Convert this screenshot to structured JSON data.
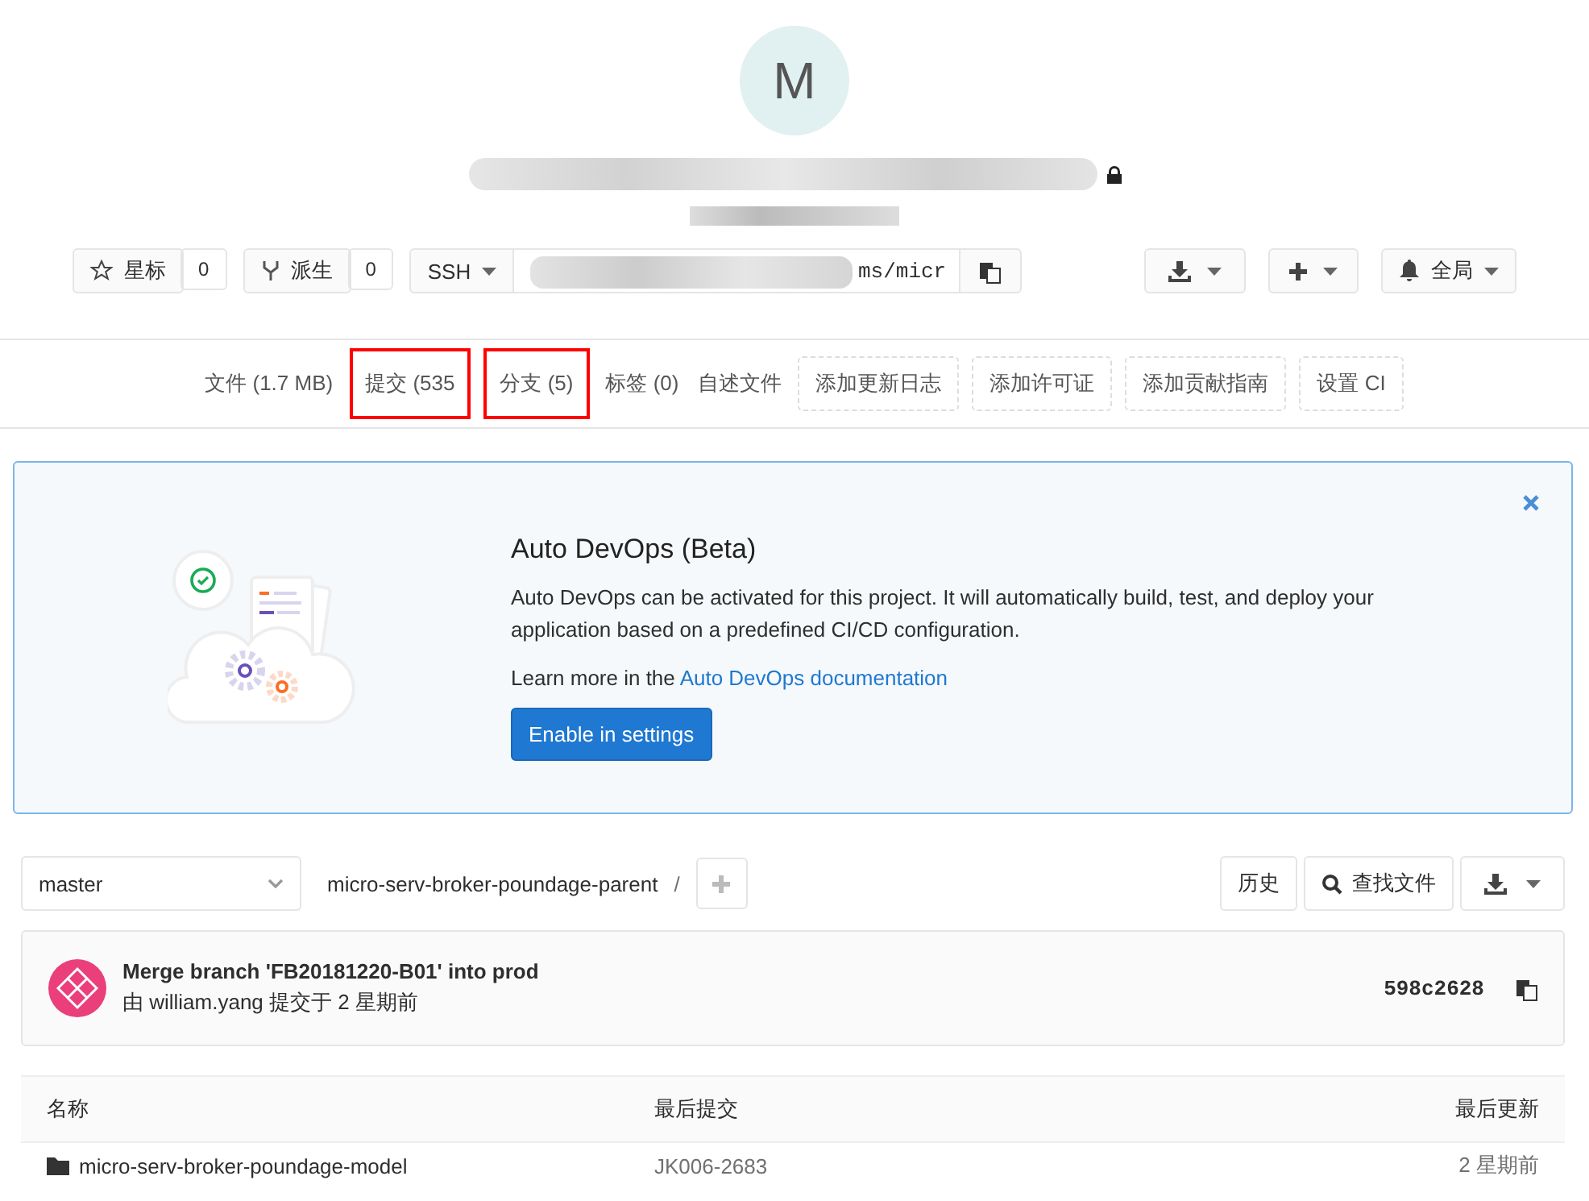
{
  "project": {
    "avatar_letter": "M",
    "private": true
  },
  "actions": {
    "star": {
      "label": "星标",
      "count": "0"
    },
    "fork": {
      "label": "派生",
      "count": "0"
    },
    "clone": {
      "protocol": "SSH",
      "url": "ms/micr"
    },
    "notification": "全局"
  },
  "nav": [
    {
      "label": "文件 (1.7 MB)",
      "kind": "link",
      "highlighted": false
    },
    {
      "label": "提交 (535",
      "kind": "link",
      "highlighted": true
    },
    {
      "label": "分支 (5)",
      "kind": "link",
      "highlighted": true
    },
    {
      "label": "标签 (0)",
      "kind": "link",
      "highlighted": false
    },
    {
      "label": "自述文件",
      "kind": "link",
      "highlighted": false
    },
    {
      "label": "添加更新日志",
      "kind": "dashed"
    },
    {
      "label": "添加许可证",
      "kind": "dashed"
    },
    {
      "label": "添加贡献指南",
      "kind": "dashed"
    },
    {
      "label": "设置 CI",
      "kind": "dashed"
    }
  ],
  "banner": {
    "title": "Auto DevOps (Beta)",
    "text": "Auto DevOps can be activated for this project. It will automatically build, test, and deploy your application based on a predefined CI/CD configuration.",
    "learn_prefix": "Learn more in the",
    "learn_link": "Auto DevOps documentation",
    "button": "Enable in settings"
  },
  "tree_bar": {
    "branch": "master",
    "path": "micro-serv-broker-poundage-parent",
    "separator": "/",
    "history": "历史",
    "find": "查找文件"
  },
  "last_commit": {
    "message": "Merge branch 'FB20181220-B01' into prod",
    "meta": "由 william.yang 提交于 2 星期前",
    "sha": "598c2628"
  },
  "table": {
    "columns": [
      "名称",
      "最后提交",
      "最后更新"
    ],
    "rows": [
      {
        "name": "micro-serv-broker-poundage-model",
        "commit": "JK006-2683",
        "updated": "2 星期前"
      }
    ]
  }
}
